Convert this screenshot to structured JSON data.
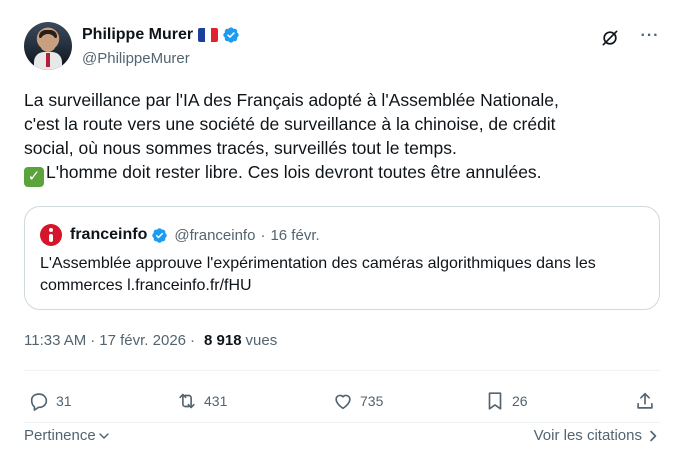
{
  "author": {
    "display_name": "Philippe Murer",
    "flag": "france-flag-emoji",
    "handle": "@PhilippeMurer",
    "verified": true
  },
  "tweet": {
    "lines": [
      "La surveillance par l'IA des Français adopté à l'Assemblée Nationale,",
      "c'est la route vers une société de surveillance à la chinoise, de crédit",
      "social, où nous sommes tracés, surveillés tout le temps.",
      "L'homme doit rester libre. Ces lois devront toutes être annulées."
    ],
    "emoji": "check-mark-button-emoji"
  },
  "quote": {
    "display_name": "franceinfo",
    "handle": "@franceinfo",
    "separator": "·",
    "date": "16 févr.",
    "lines": [
      "L'Assemblée approuve l'expérimentation des caméras algorithmiques dans les",
      "commerces l.franceinfo.fr/fHU"
    ]
  },
  "meta": {
    "time": "11:33 AM",
    "separator": "·",
    "date": "17 févr. 2026",
    "views_count": "8 918",
    "views_label": "vues"
  },
  "actions": {
    "replies": "31",
    "reposts": "431",
    "likes": "735",
    "bookmarks": "26"
  },
  "footer": {
    "sort_label": "Pertinence",
    "quotes_label": "Voir les citations"
  },
  "colors": {
    "text": "#0f1419",
    "secondary": "#536471",
    "verified": "#1d9bf0",
    "border": "#cfd9de",
    "franceinfo_red": "#d6142b"
  }
}
